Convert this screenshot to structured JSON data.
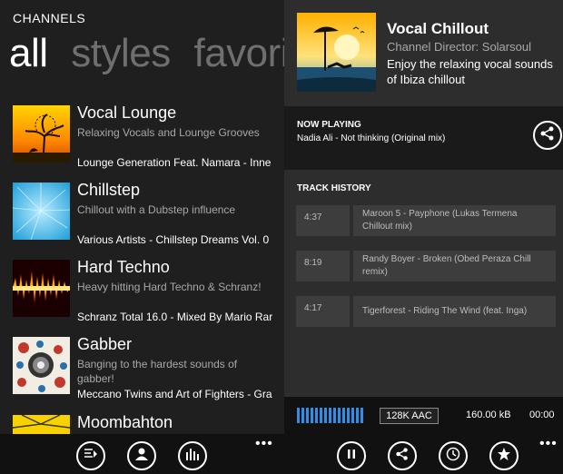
{
  "left": {
    "app_title": "CHANNELS",
    "pivot": [
      "all",
      "styles",
      "favorites"
    ],
    "pivot_visible": [
      "all",
      "styles",
      "favori"
    ],
    "channels": [
      {
        "name": "Vocal Lounge",
        "desc": "Relaxing Vocals and Lounge Grooves",
        "track": "Lounge Generation Feat. Namara - Inne"
      },
      {
        "name": "Chillstep",
        "desc": "Chillout with a Dubstep influence",
        "track": "Various Artists - Chillstep Dreams Vol. 0"
      },
      {
        "name": "Hard Techno",
        "desc": "Heavy hitting Hard Techno & Schranz!",
        "track": "Schranz Total 16.0 - Mixed By Mario Rar"
      },
      {
        "name": "Gabber",
        "desc": "Banging to the hardest sounds of gabber!",
        "track": "Meccano Twins and Art of Fighters - Gra"
      },
      {
        "name": "Moombahton",
        "desc": "",
        "track": ""
      }
    ],
    "appbar": {
      "more": "•••",
      "icons": [
        "channels-list-icon",
        "user-icon",
        "equalizer-icon"
      ]
    }
  },
  "right": {
    "channel": {
      "title": "Vocal Chillout",
      "director": "Channel Director: Solarsoul",
      "description": "Enjoy the relaxing vocal sounds of Ibiza chillout"
    },
    "now_playing": {
      "label": "NOW PLAYING",
      "track": "Nadia Ali - Not thinking (Original mix)"
    },
    "history": {
      "label": "TRACK HISTORY",
      "items": [
        {
          "time": "4:37",
          "title": "Maroon 5 - Payphone (Lukas Termena Chillout mix)"
        },
        {
          "time": "8:19",
          "title": "Randy Boyer - Broken (Obed Peraza Chill remix)"
        },
        {
          "time": "4:17",
          "title": "Tigerforest - Riding The Wind (feat. Inga)"
        }
      ]
    },
    "status": {
      "bitrate": "128K AAC",
      "size": "160.00 kB",
      "elapsed": "00:00",
      "buffer_level": 1.0
    },
    "appbar": {
      "more": "•••",
      "icons": [
        "pause-icon",
        "share-icon",
        "sleep-timer-icon",
        "favorite-star-icon"
      ]
    }
  },
  "colors": {
    "accent": "#2d8fe8",
    "panel": "#2d2d2d",
    "background": "#1f1f1f"
  }
}
